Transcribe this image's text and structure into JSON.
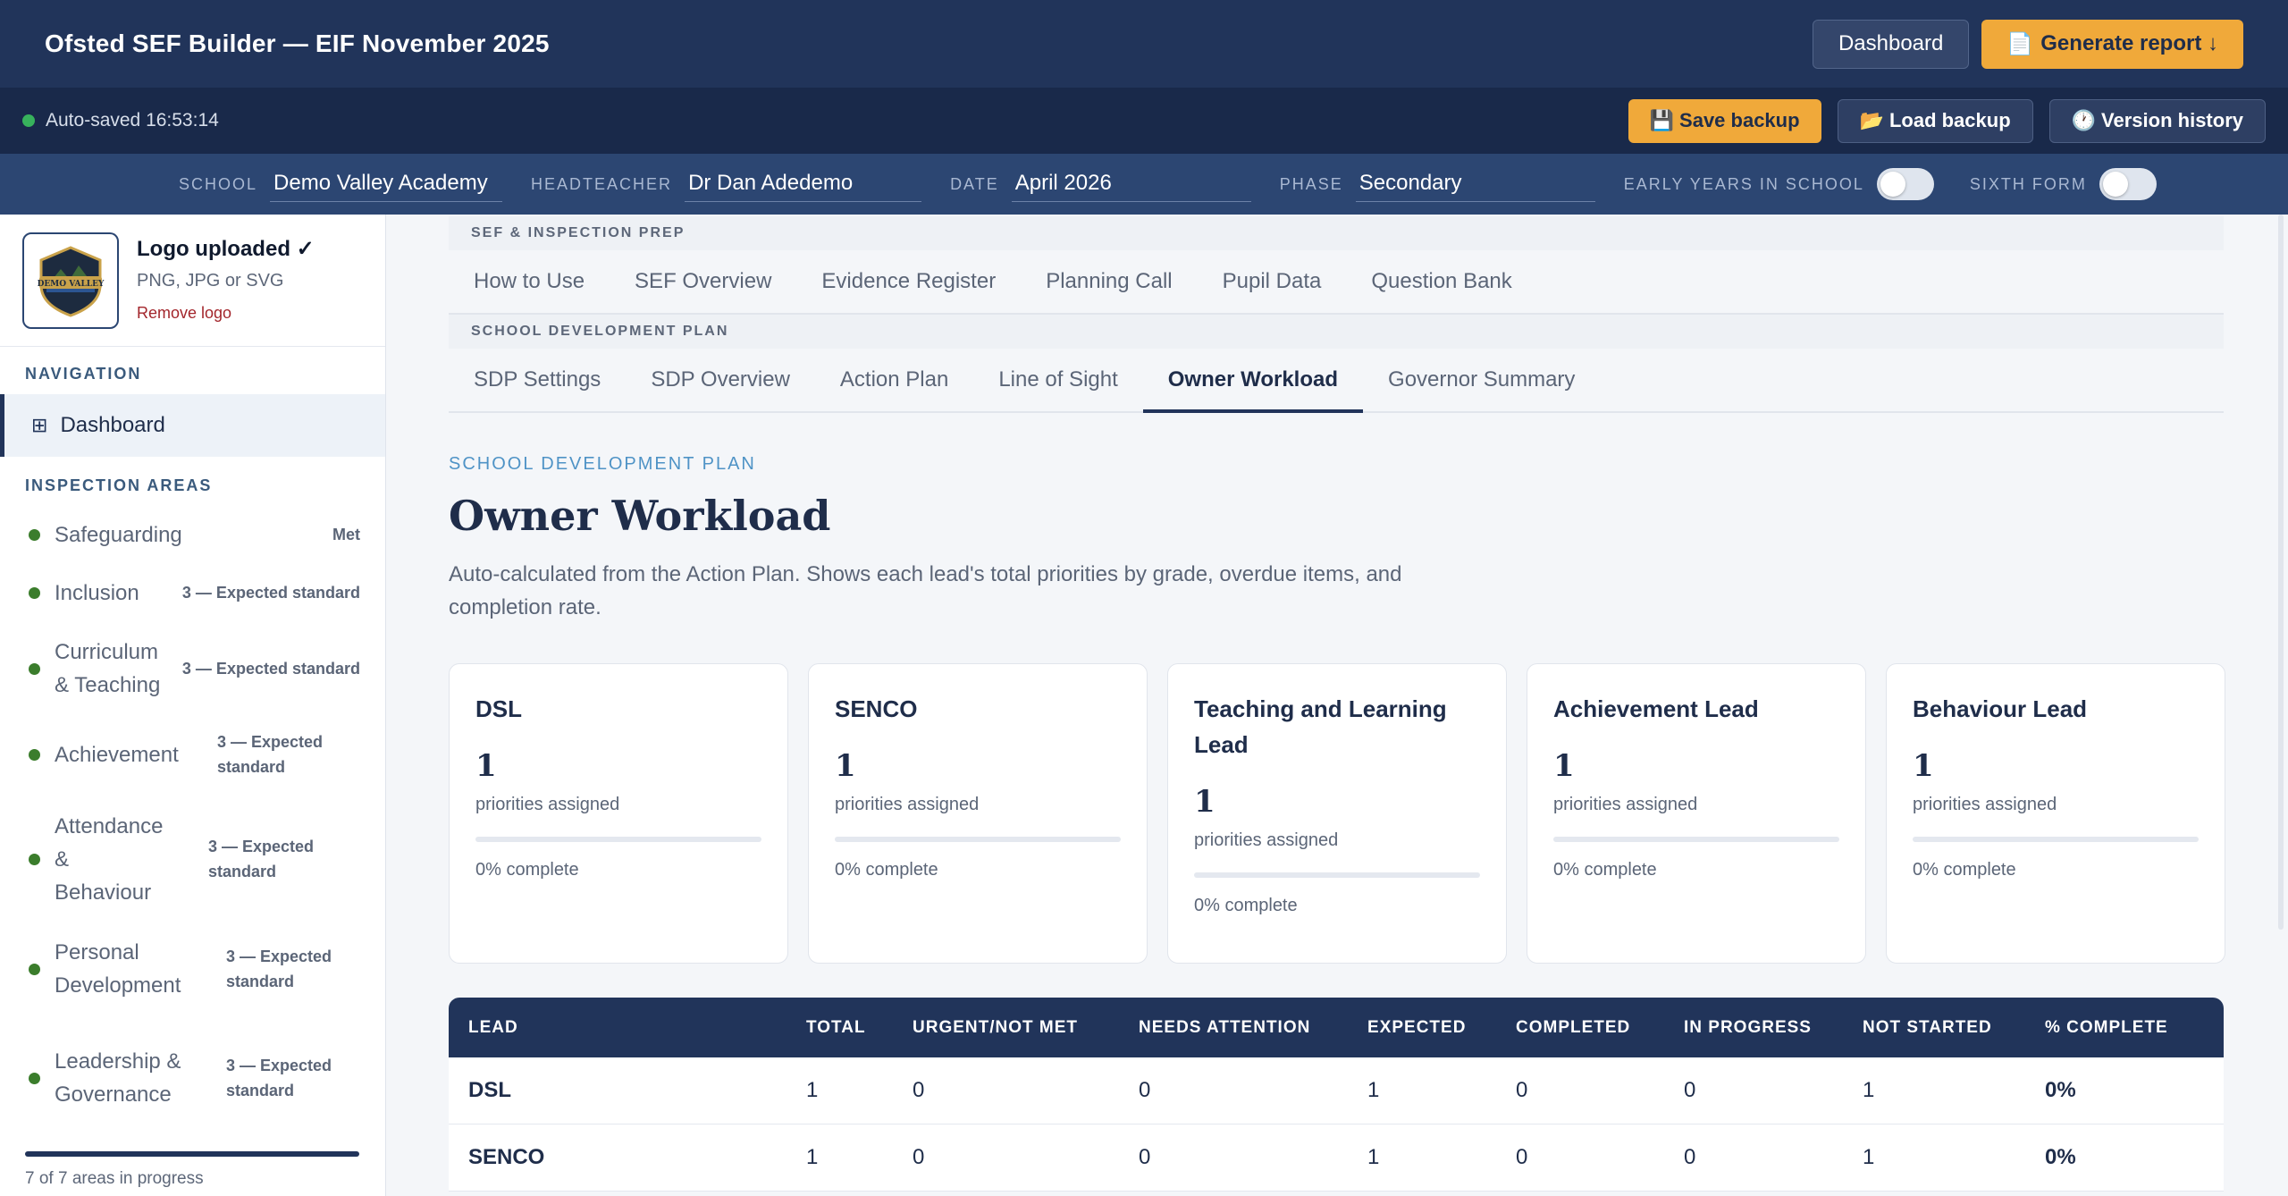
{
  "app": {
    "title": "Ofsted SEF Builder — EIF November 2025",
    "dashboard_label": "Dashboard",
    "generate_label": "Generate report ↓"
  },
  "savebar": {
    "status": "Auto-saved 16:53:14",
    "save_backup": "Save backup",
    "load_backup": "Load backup",
    "version_history": "Version history"
  },
  "school": {
    "school_label": "SCHOOL",
    "school_value": "Demo Valley Academy",
    "head_label": "HEADTEACHER",
    "head_value": "Dr Dan Adedemo",
    "date_label": "DATE",
    "date_value": "April 2026",
    "phase_label": "PHASE",
    "phase_value": "Secondary",
    "early_years_label": "EARLY YEARS IN SCHOOL",
    "early_years_on": false,
    "sixth_form_label": "SIXTH FORM",
    "sixth_form_on": false
  },
  "sidebar": {
    "logo_title": "Logo uploaded ✓",
    "logo_formats": "PNG, JPG or SVG",
    "logo_remove": "Remove logo",
    "logo_text": "DEMO VALLEY",
    "nav_heading": "NAVIGATION",
    "dashboard": "Dashboard",
    "areas_heading": "INSPECTION AREAS",
    "areas": [
      {
        "name": "Safeguarding",
        "status": "Met"
      },
      {
        "name": "Inclusion",
        "status": "3 — Expected standard"
      },
      {
        "name": "Curriculum & Teaching",
        "status": "3 — Expected standard"
      },
      {
        "name": "Achievement",
        "status": "3 — Expected standard"
      },
      {
        "name": "Attendance & Behaviour",
        "status": "3 — Expected standard"
      },
      {
        "name": "Personal Development",
        "status": "3 — Expected standard"
      },
      {
        "name": "Leadership & Governance",
        "status": "3 — Expected standard"
      }
    ],
    "progress_fraction": 1.0,
    "footer": "7 of 7 areas in progress"
  },
  "tabs": {
    "group1_label": "SEF & INSPECTION PREP",
    "group1": [
      "How to Use",
      "SEF Overview",
      "Evidence Register",
      "Planning Call",
      "Pupil Data",
      "Question Bank"
    ],
    "group2_label": "SCHOOL DEVELOPMENT PLAN",
    "group2": [
      "SDP Settings",
      "SDP Overview",
      "Action Plan",
      "Line of Sight",
      "Owner Workload",
      "Governor Summary"
    ],
    "active": "Owner Workload"
  },
  "page": {
    "eyebrow": "SCHOOL DEVELOPMENT PLAN",
    "title": "Owner Workload",
    "description": "Auto-calculated from the Action Plan. Shows each lead's total priorities by grade, overdue items, and completion rate."
  },
  "cards": [
    {
      "name": "DSL",
      "count": "1",
      "sub": "priorities assigned",
      "complete_pct": 0,
      "complete_label": "0% complete"
    },
    {
      "name": "SENCO",
      "count": "1",
      "sub": "priorities assigned",
      "complete_pct": 0,
      "complete_label": "0% complete"
    },
    {
      "name": "Teaching and Learning Lead",
      "count": "1",
      "sub": "priorities assigned",
      "complete_pct": 0,
      "complete_label": "0% complete"
    },
    {
      "name": "Achievement Lead",
      "count": "1",
      "sub": "priorities assigned",
      "complete_pct": 0,
      "complete_label": "0% complete"
    },
    {
      "name": "Behaviour Lead",
      "count": "1",
      "sub": "priorities assigned",
      "complete_pct": 0,
      "complete_label": "0% complete"
    }
  ],
  "table": {
    "headers": [
      "LEAD",
      "TOTAL",
      "URGENT/NOT MET",
      "NEEDS ATTENTION",
      "EXPECTED",
      "COMPLETED",
      "IN PROGRESS",
      "NOT STARTED",
      "% COMPLETE"
    ],
    "rows": [
      [
        "DSL",
        "1",
        "0",
        "0",
        "1",
        "0",
        "0",
        "1",
        "0%"
      ],
      [
        "SENCO",
        "1",
        "0",
        "0",
        "1",
        "0",
        "0",
        "1",
        "0%"
      ]
    ]
  },
  "colors": {
    "navy": "#21345a",
    "accent_orange": "#f0a93a",
    "status_green": "#3b7d2c",
    "saved_green": "#37b25c",
    "eyebrow_blue": "#4f93c6"
  }
}
